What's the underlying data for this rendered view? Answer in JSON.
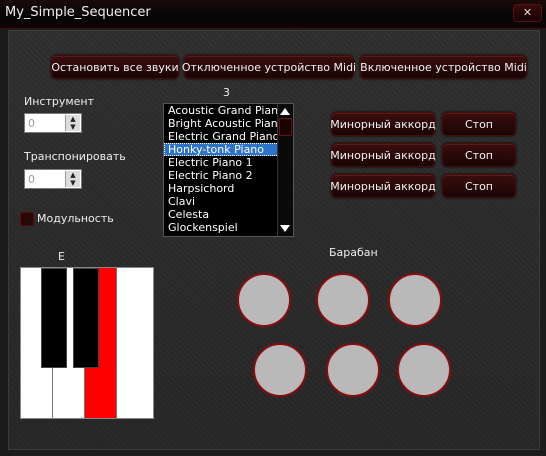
{
  "window": {
    "title": "My_Simple_Sequencer",
    "close_label": "✕"
  },
  "toolbar": {
    "stop_all": "Остановить все звуки",
    "midi_off": "Отключенное устройство Midi",
    "midi_on": "Включенное устройство Midi"
  },
  "instrument": {
    "label": "Инструмент",
    "value": "0"
  },
  "transpose": {
    "label": "Транспонировать",
    "value": "0"
  },
  "modulation": {
    "label": "Модульность",
    "checked": false
  },
  "list": {
    "header": "3",
    "items": [
      "Acoustic Grand Piano",
      "Bright Acoustic Piano",
      "Electric Grand Piano",
      "Honky-tonk Piano",
      "Electric Piano 1",
      "Electric Piano 2",
      "Harpsichord",
      "Clavi",
      "Celesta",
      "Glockenspiel"
    ],
    "selected_index": 3
  },
  "chords": [
    {
      "chord": "Минорный аккорд",
      "stop": "Стоп"
    },
    {
      "chord": "Минорный аккорд",
      "stop": "Стоп"
    },
    {
      "chord": "Минорный аккорд",
      "stop": "Стоп"
    }
  ],
  "piano": {
    "note_label": "E",
    "pressed_key": "E",
    "pressed_color": "#ff0000"
  },
  "drum": {
    "label": "Барабан",
    "pad_color": "#b9b9b9",
    "rim_color": "#8a0c0c"
  },
  "colors": {
    "accent": "#8a0c0c",
    "selection": "#2d73c9"
  }
}
